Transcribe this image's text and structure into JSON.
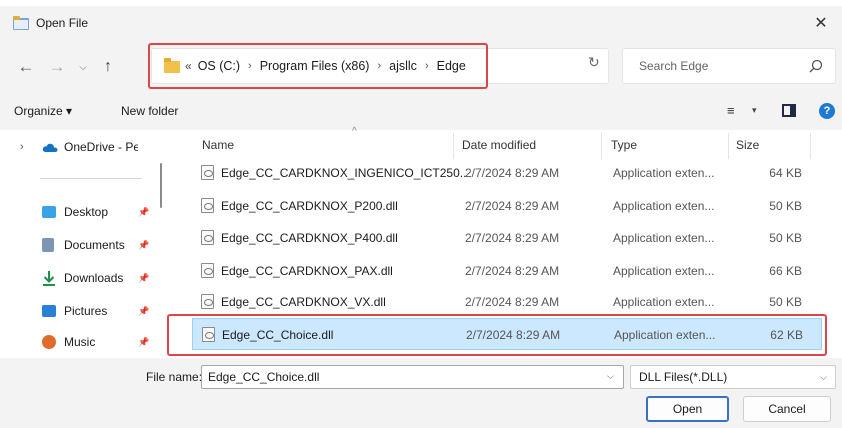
{
  "window": {
    "title": "Open File"
  },
  "navigation": {
    "breadcrumb": [
      "OS (C:)",
      "Program Files (x86)",
      "ajsllc",
      "Edge"
    ],
    "overflow": "«"
  },
  "search": {
    "placeholder": "Search Edge"
  },
  "commandbar": {
    "organize": "Organize ▾",
    "new_folder": "New folder"
  },
  "sidebar": {
    "items": [
      {
        "label": "OneDrive - Pers",
        "icon": "onedrive-cloud-icon",
        "color": "#1473c4",
        "expandable": true,
        "pinned": false
      },
      {
        "label": "Desktop",
        "icon": "desktop-icon",
        "color": "#3aa2e8",
        "expandable": false,
        "pinned": true
      },
      {
        "label": "Documents",
        "icon": "documents-icon",
        "color": "#7d94b4",
        "expandable": false,
        "pinned": true
      },
      {
        "label": "Downloads",
        "icon": "downloads-icon",
        "color": "#1f8f4b",
        "expandable": false,
        "pinned": true
      },
      {
        "label": "Pictures",
        "icon": "pictures-icon",
        "color": "#2a7fd6",
        "expandable": false,
        "pinned": true
      },
      {
        "label": "Music",
        "icon": "music-icon",
        "color": "#e06c2a",
        "expandable": false,
        "pinned": true
      }
    ]
  },
  "filelist": {
    "columns": [
      "Name",
      "Date modified",
      "Type",
      "Size"
    ],
    "rows": [
      {
        "name": "Edge_CC_CARDKNOX_INGENICO_ICT250...",
        "date": "2/7/2024 8:29 AM",
        "type": "Application exten...",
        "size": "64 KB",
        "selected": false
      },
      {
        "name": "Edge_CC_CARDKNOX_P200.dll",
        "date": "2/7/2024 8:29 AM",
        "type": "Application exten...",
        "size": "50 KB",
        "selected": false
      },
      {
        "name": "Edge_CC_CARDKNOX_P400.dll",
        "date": "2/7/2024 8:29 AM",
        "type": "Application exten...",
        "size": "50 KB",
        "selected": false
      },
      {
        "name": "Edge_CC_CARDKNOX_PAX.dll",
        "date": "2/7/2024 8:29 AM",
        "type": "Application exten...",
        "size": "66 KB",
        "selected": false
      },
      {
        "name": "Edge_CC_CARDKNOX_VX.dll",
        "date": "2/7/2024 8:29 AM",
        "type": "Application exten...",
        "size": "50 KB",
        "selected": false
      },
      {
        "name": "Edge_CC_Choice.dll",
        "date": "2/7/2024 8:29 AM",
        "type": "Application exten...",
        "size": "62 KB",
        "selected": true
      }
    ]
  },
  "footer": {
    "file_name_label": "File name:",
    "file_name_value": "Edge_CC_Choice.dll",
    "file_type": "DLL Files(*.DLL)",
    "open_label": "Open",
    "cancel_label": "Cancel"
  },
  "colors": {
    "annotation": "#d9474a",
    "selection": "#cce8ff",
    "accent": "#1f7ad1"
  }
}
